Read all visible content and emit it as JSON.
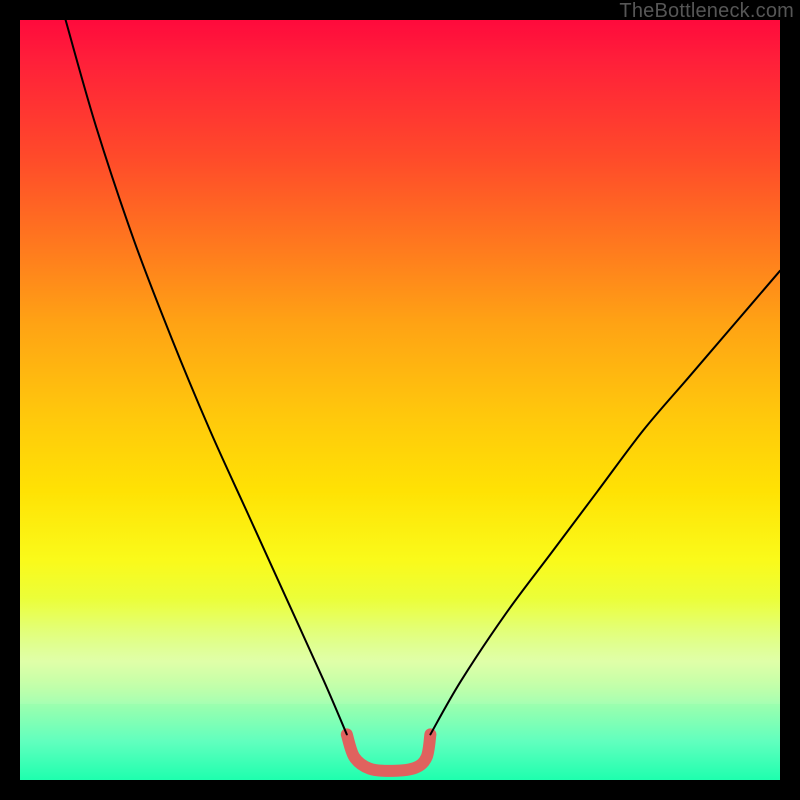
{
  "watermark": "TheBottleneck.com",
  "chart_data": {
    "type": "line",
    "title": "",
    "xlabel": "",
    "ylabel": "",
    "xlim": [
      0,
      100
    ],
    "ylim": [
      0,
      100
    ],
    "grid": false,
    "legend": false,
    "series": [
      {
        "name": "left-descent",
        "stroke": "#000000",
        "stroke_width": 2,
        "x": [
          6,
          10,
          15,
          20,
          25,
          30,
          35,
          40,
          43
        ],
        "y": [
          100,
          86,
          71,
          58,
          46,
          35,
          24,
          13,
          6
        ]
      },
      {
        "name": "right-ascent",
        "stroke": "#000000",
        "stroke_width": 2,
        "x": [
          54,
          58,
          64,
          70,
          76,
          82,
          88,
          94,
          100
        ],
        "y": [
          6,
          13,
          22,
          30,
          38,
          46,
          53,
          60,
          67
        ]
      },
      {
        "name": "valley-highlight",
        "stroke": "#e0625e",
        "stroke_width": 12,
        "x": [
          43,
          44,
          46,
          49,
          52,
          53.5,
          54
        ],
        "y": [
          6,
          3,
          1.5,
          1.2,
          1.6,
          3,
          6
        ]
      }
    ],
    "annotations": []
  },
  "colors": {
    "frame": "#000000",
    "highlight": "#e0625e"
  }
}
